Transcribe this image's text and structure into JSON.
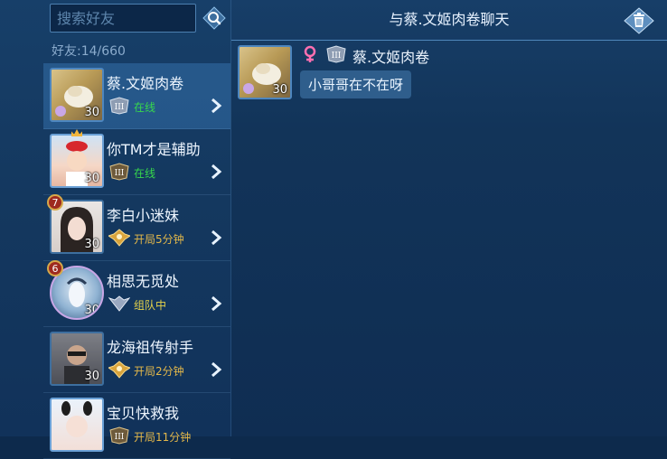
{
  "search": {
    "placeholder": "搜索好友"
  },
  "friend_count": "好友:14/660",
  "friends": [
    {
      "name": "蔡.文姬肉卷",
      "level": "30",
      "status": "在线",
      "rank_numeral": "III"
    },
    {
      "name": "你TM才是辅助",
      "level": "30",
      "status": "在线",
      "rank_numeral": "III"
    },
    {
      "name": "李白小迷妹",
      "level": "30",
      "status": "开局5分钟",
      "badge": "7"
    },
    {
      "name": "相思无觅处",
      "level": "30",
      "status": "组队中",
      "badge": "6"
    },
    {
      "name": "龙海祖传射手",
      "level": "30",
      "status": "开局2分钟"
    },
    {
      "name": "宝贝快救我",
      "level": "",
      "status": "开局11分钟",
      "rank_numeral": "III"
    }
  ],
  "chat": {
    "title": "与蔡.文姬肉卷聊天",
    "sender": {
      "name": "蔡.文姬肉卷",
      "level": "30",
      "rank_numeral": "III"
    },
    "message": "小哥哥在不在呀"
  },
  "colors": {
    "online": "#37d84c",
    "in_game": "#e4b84a",
    "in_team": "#e4d24a",
    "female": "#ff6fb1",
    "active_row": "#3f7fbd"
  },
  "icons": {
    "search": "magnifier-icon",
    "trash": "trash-icon",
    "chevron": "chevron-right-icon",
    "gender": "female-icon"
  }
}
